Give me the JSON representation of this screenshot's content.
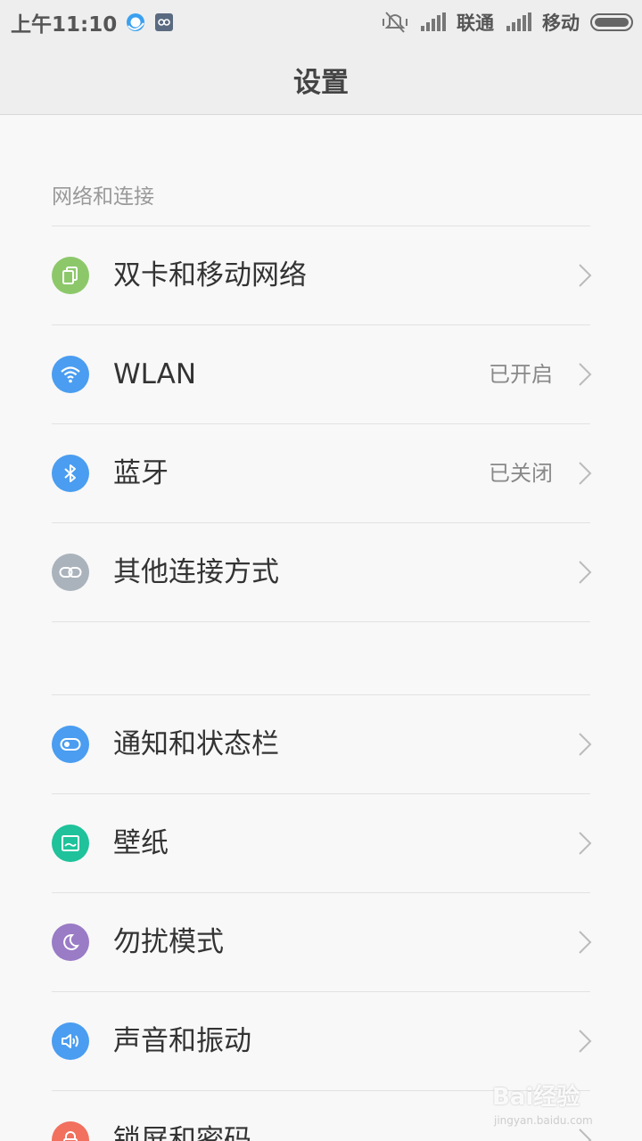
{
  "status_bar": {
    "time": "上午11:10",
    "carrier1": "联通",
    "carrier2": "移动"
  },
  "title": "设置",
  "section_network": {
    "header": "网络和连接",
    "items": [
      {
        "label": "双卡和移动网络",
        "value": "",
        "icon": "dual-sim-icon",
        "color": "#8cc86a"
      },
      {
        "label": "WLAN",
        "value": "已开启",
        "icon": "wifi-icon",
        "color": "#4a9df0"
      },
      {
        "label": "蓝牙",
        "value": "已关闭",
        "icon": "bluetooth-icon",
        "color": "#4a9df0"
      },
      {
        "label": "其他连接方式",
        "value": "",
        "icon": "link-icon",
        "color": "#aab3bc"
      }
    ]
  },
  "section_personal": {
    "items": [
      {
        "label": "通知和状态栏",
        "value": "",
        "icon": "toggle-icon",
        "color": "#4a9df0"
      },
      {
        "label": "壁纸",
        "value": "",
        "icon": "wallpaper-icon",
        "color": "#1fc29a"
      },
      {
        "label": "勿扰模式",
        "value": "",
        "icon": "moon-icon",
        "color": "#9a7bc6"
      },
      {
        "label": "声音和振动",
        "value": "",
        "icon": "speaker-icon",
        "color": "#4a9df0"
      },
      {
        "label": "锁屏和密码",
        "value": "",
        "icon": "lock-icon",
        "color": "#f2705e"
      }
    ]
  },
  "watermark": {
    "brand": "Bai经验",
    "url": "jingyan.baidu.com"
  }
}
